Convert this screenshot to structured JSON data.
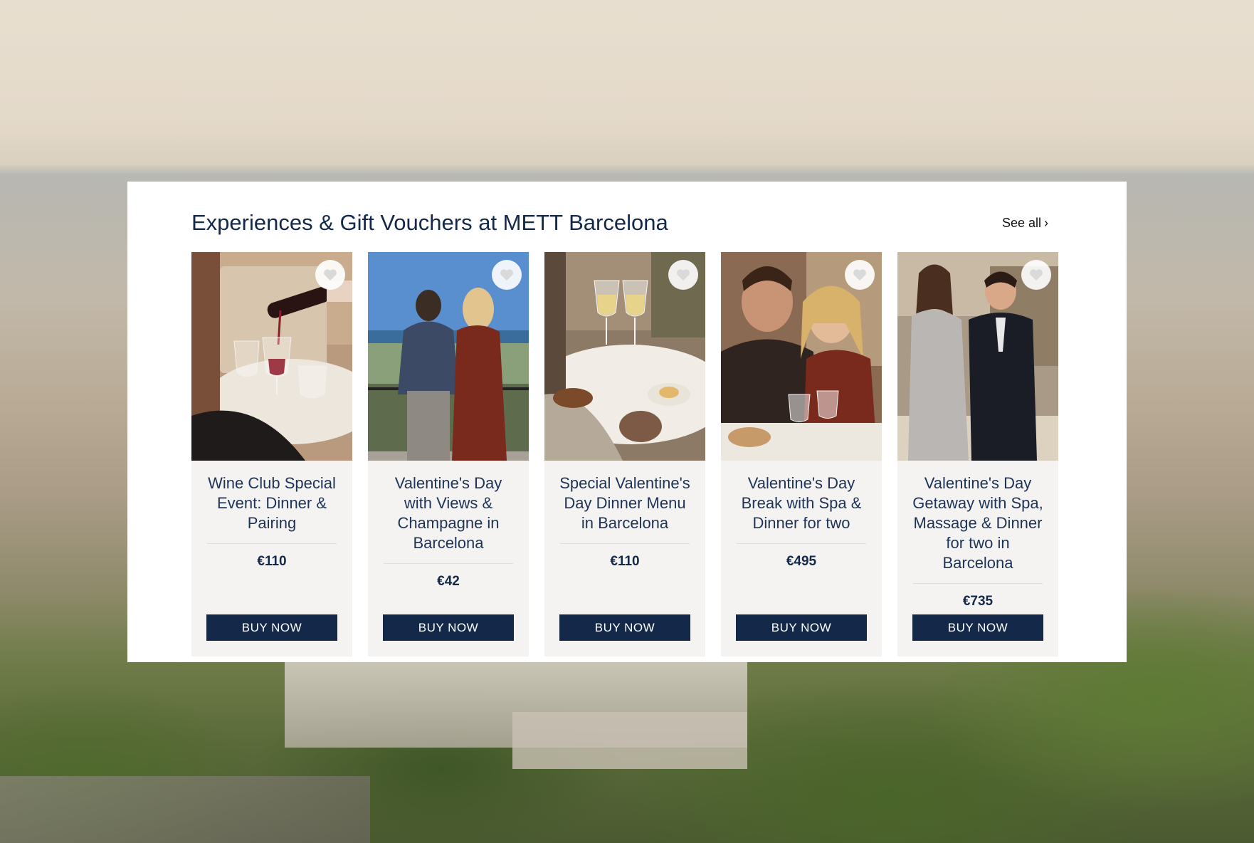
{
  "section": {
    "title": "Experiences & Gift Vouchers at METT Barcelona",
    "see_all_label": "See all",
    "see_all_chevron": "›"
  },
  "cards": [
    {
      "title": "Wine Club Special Event: Dinner & Pairing",
      "price": "€110",
      "button_label": "BUY NOW",
      "image_icon": "wine-pouring-photo"
    },
    {
      "title": "Valentine's Day with Views & Champagne in Barcelona",
      "price": "€42",
      "button_label": "BUY NOW",
      "image_icon": "couple-terrace-photo"
    },
    {
      "title": "Special Valentine's Day Dinner Menu in Barcelona",
      "price": "€110",
      "button_label": "BUY NOW",
      "image_icon": "champagne-toast-photo"
    },
    {
      "title": "Valentine's Day Break with Spa & Dinner for two",
      "price": "€495",
      "button_label": "BUY NOW",
      "image_icon": "couple-dinner-photo"
    },
    {
      "title": "Valentine's Day Getaway with Spa, Massage & Dinner for two in Barcelona",
      "price": "€735",
      "button_label": "BUY NOW",
      "image_icon": "couple-lobby-photo"
    }
  ],
  "colors": {
    "brand_navy": "#14294a",
    "card_background": "#f5f3f1"
  }
}
